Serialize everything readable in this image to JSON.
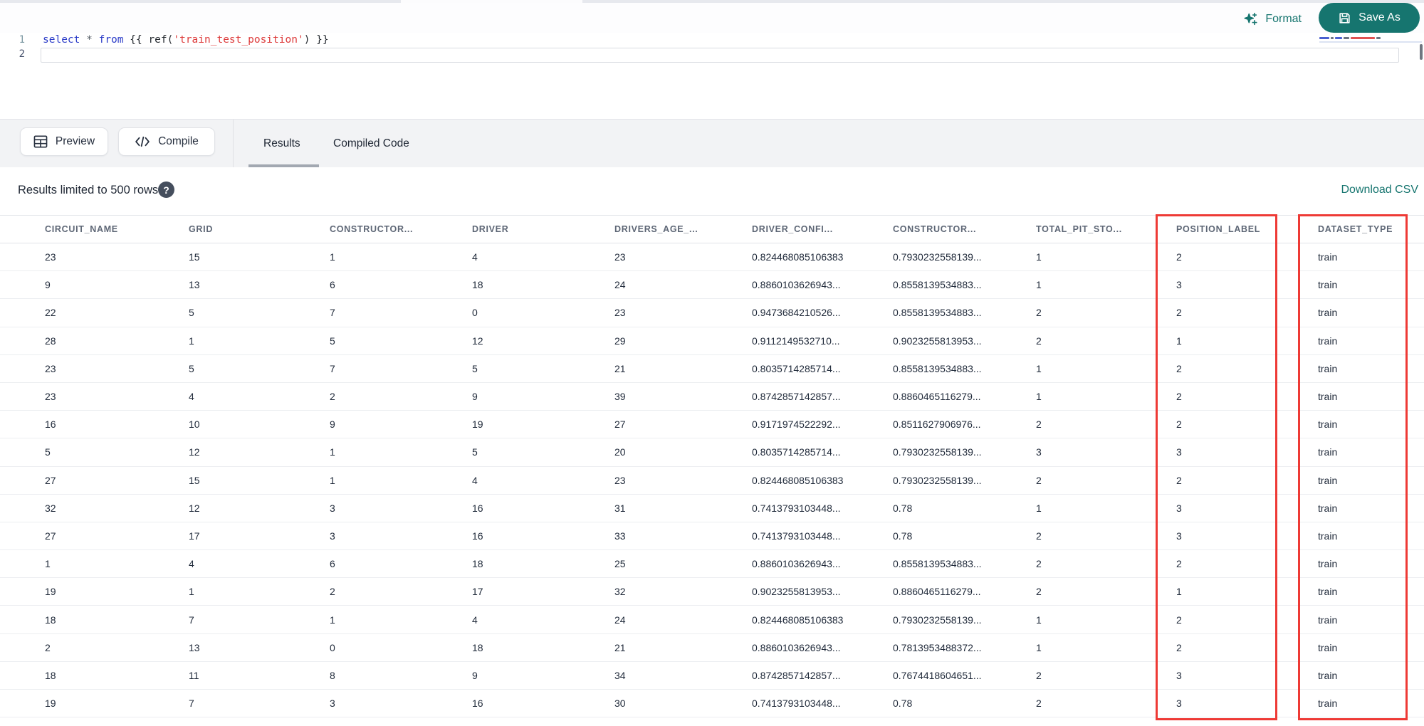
{
  "colors": {
    "accent_teal": "#16756f",
    "annotation_red": "#ee3a35",
    "header_text": "#5d6675",
    "cell_text": "#212b3b"
  },
  "toolbar": {
    "format_label": "Format",
    "save_as_label": "Save As"
  },
  "editor": {
    "line_numbers": [
      "1",
      "2"
    ],
    "code_plain": "select * from {{ ref('train_test_position') }}",
    "tokens": [
      {
        "t": "select",
        "c": "kw"
      },
      {
        "t": " ",
        "c": "pl"
      },
      {
        "t": "*",
        "c": "op"
      },
      {
        "t": " ",
        "c": "pl"
      },
      {
        "t": "from",
        "c": "kw"
      },
      {
        "t": " {{ ",
        "c": "pl"
      },
      {
        "t": "ref(",
        "c": "pl"
      },
      {
        "t": "'train_test_position'",
        "c": "str"
      },
      {
        "t": ")",
        "c": "pl"
      },
      {
        "t": " }}",
        "c": "pl"
      }
    ]
  },
  "actionbar": {
    "preview_label": "Preview",
    "compile_label": "Compile",
    "tabs": [
      {
        "label": "Results",
        "active": true
      },
      {
        "label": "Compiled Code",
        "active": false
      }
    ]
  },
  "results_info": {
    "limit_text": "Results limited to 500 rows.",
    "help_icon": "?",
    "download_label": "Download CSV"
  },
  "table": {
    "columns": [
      "CIRCUIT_NAME",
      "GRID",
      "CONSTRUCTOR...",
      "DRIVER",
      "DRIVERS_AGE_...",
      "DRIVER_CONFI...",
      "CONSTRUCTOR...",
      "TOTAL_PIT_STO...",
      "POSITION_LABEL",
      "DATASET_TYPE"
    ],
    "rows": [
      [
        "23",
        "15",
        "1",
        "4",
        "23",
        "0.824468085106383",
        "0.7930232558139...",
        "1",
        "2",
        "train"
      ],
      [
        "9",
        "13",
        "6",
        "18",
        "24",
        "0.8860103626943...",
        "0.8558139534883...",
        "1",
        "3",
        "train"
      ],
      [
        "22",
        "5",
        "7",
        "0",
        "23",
        "0.9473684210526...",
        "0.8558139534883...",
        "2",
        "2",
        "train"
      ],
      [
        "28",
        "1",
        "5",
        "12",
        "29",
        "0.9112149532710...",
        "0.9023255813953...",
        "2",
        "1",
        "train"
      ],
      [
        "23",
        "5",
        "7",
        "5",
        "21",
        "0.8035714285714...",
        "0.8558139534883...",
        "1",
        "2",
        "train"
      ],
      [
        "23",
        "4",
        "2",
        "9",
        "39",
        "0.8742857142857...",
        "0.8860465116279...",
        "1",
        "2",
        "train"
      ],
      [
        "16",
        "10",
        "9",
        "19",
        "27",
        "0.9171974522292...",
        "0.8511627906976...",
        "2",
        "2",
        "train"
      ],
      [
        "5",
        "12",
        "1",
        "5",
        "20",
        "0.8035714285714...",
        "0.7930232558139...",
        "3",
        "3",
        "train"
      ],
      [
        "27",
        "15",
        "1",
        "4",
        "23",
        "0.824468085106383",
        "0.7930232558139...",
        "2",
        "2",
        "train"
      ],
      [
        "32",
        "12",
        "3",
        "16",
        "31",
        "0.7413793103448...",
        "0.78",
        "1",
        "3",
        "train"
      ],
      [
        "27",
        "17",
        "3",
        "16",
        "33",
        "0.7413793103448...",
        "0.78",
        "2",
        "3",
        "train"
      ],
      [
        "1",
        "4",
        "6",
        "18",
        "25",
        "0.8860103626943...",
        "0.8558139534883...",
        "2",
        "2",
        "train"
      ],
      [
        "19",
        "1",
        "2",
        "17",
        "32",
        "0.9023255813953...",
        "0.8860465116279...",
        "2",
        "1",
        "train"
      ],
      [
        "18",
        "7",
        "1",
        "4",
        "24",
        "0.824468085106383",
        "0.7930232558139...",
        "1",
        "2",
        "train"
      ],
      [
        "2",
        "13",
        "0",
        "18",
        "21",
        "0.8860103626943...",
        "0.7813953488372...",
        "1",
        "2",
        "train"
      ],
      [
        "18",
        "11",
        "8",
        "9",
        "34",
        "0.8742857142857...",
        "0.7674418604651...",
        "2",
        "3",
        "train"
      ],
      [
        "19",
        "7",
        "3",
        "16",
        "30",
        "0.7413793103448...",
        "0.78",
        "2",
        "3",
        "train"
      ]
    ],
    "annotations": [
      {
        "column": "POSITION_LABEL",
        "color": "#ee3a35"
      },
      {
        "column": "DATASET_TYPE",
        "color": "#ee3a35"
      }
    ]
  }
}
